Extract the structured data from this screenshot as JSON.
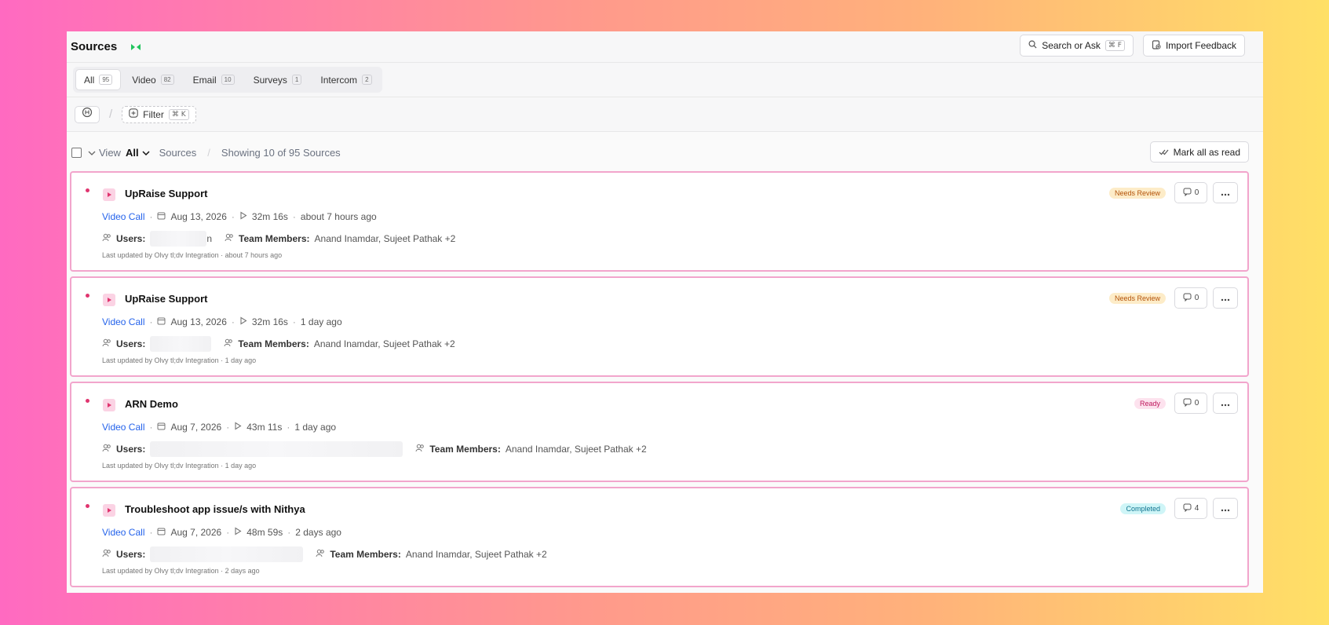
{
  "header": {
    "title": "Sources",
    "search_label": "Search or Ask",
    "search_kbd": "⌘ F",
    "import_label": "Import Feedback"
  },
  "tabs": [
    {
      "label": "All",
      "count": "95"
    },
    {
      "label": "Video",
      "count": "82"
    },
    {
      "label": "Email",
      "count": "10"
    },
    {
      "label": "Surveys",
      "count": "1"
    },
    {
      "label": "Intercom",
      "count": "2"
    }
  ],
  "filter": {
    "label": "Filter",
    "kbd": "⌘ K"
  },
  "view": {
    "view_label": "View",
    "selected": "All",
    "sources_label": "Sources",
    "showing": "Showing 10 of 95 Sources",
    "mark_all": "Mark all as read"
  },
  "cards": [
    {
      "title": "UpRaise Support",
      "type": "Video Call",
      "date": "Aug 13, 2026",
      "duration": "32m 16s",
      "ago": "about 7 hours ago",
      "users_label": "Users:",
      "users_tail": "n",
      "team_label": "Team Members:",
      "team": "Anand Inamdar, Sujeet Pathak +2",
      "updated": "Last updated by Olvy tl;dv Integration · about 7 hours ago",
      "status": "Needs Review",
      "comments": "0"
    },
    {
      "title": "UpRaise Support",
      "type": "Video Call",
      "date": "Aug 13, 2026",
      "duration": "32m 16s",
      "ago": "1 day ago",
      "users_label": "Users:",
      "users_tail": "",
      "team_label": "Team Members:",
      "team": "Anand Inamdar, Sujeet Pathak +2",
      "updated": "Last updated by Olvy tl;dv Integration · 1 day ago",
      "status": "Needs Review",
      "comments": "0"
    },
    {
      "title": "ARN Demo",
      "type": "Video Call",
      "date": "Aug 7, 2026",
      "duration": "43m 11s",
      "ago": "1 day ago",
      "users_label": "Users:",
      "users_tail": "",
      "team_label": "Team Members:",
      "team": "Anand Inamdar, Sujeet Pathak +2",
      "updated": "Last updated by Olvy tl;dv Integration · 1 day ago",
      "status": "Ready",
      "comments": "0"
    },
    {
      "title": "Troubleshoot app issue/s with Nithya",
      "type": "Video Call",
      "date": "Aug 7, 2026",
      "duration": "48m 59s",
      "ago": "2 days ago",
      "users_label": "Users:",
      "users_tail": "",
      "team_label": "Team Members:",
      "team": "Anand Inamdar, Sujeet Pathak +2",
      "updated": "Last updated by Olvy tl;dv Integration · 2 days ago",
      "status": "Completed",
      "comments": "4"
    }
  ],
  "colors": {
    "accent_blue": "#2563eb",
    "card_border": "#f2a5cc",
    "unread_dot": "#e0356f"
  }
}
